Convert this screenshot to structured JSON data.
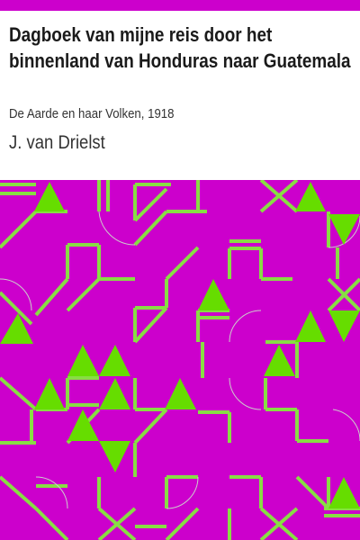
{
  "book": {
    "title": "Dagboek van mijne reis door het binnenland van Honduras naar Guatemala",
    "subtitle": "De Aarde en haar Volken, 1918",
    "author": "J. van Drielst"
  },
  "colors": {
    "accent": "#cc00cc",
    "pattern_line": "#88dd44",
    "pattern_fill": "#66dd00",
    "text": "#1a1a1a"
  }
}
